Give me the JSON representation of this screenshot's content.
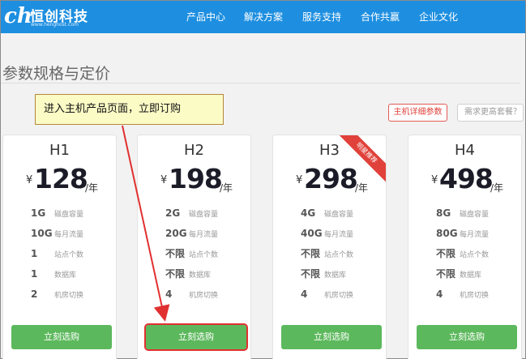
{
  "brand": {
    "mark": "ch",
    "name": "恒创科技",
    "url": "www.henghost.com"
  },
  "nav": [
    "产品中心",
    "解决方案",
    "服务支持",
    "合作共赢",
    "企业文化"
  ],
  "page": {
    "title": "参数规格与定价",
    "detail_button": "主机详细参数",
    "more_button": "需求更高套餐？"
  },
  "annotation": {
    "text": "进入主机产品页面，立即订购",
    "color": "#e13030"
  },
  "colors": {
    "nav_bg": "#1e8fe0",
    "buy_button": "#5cb85c",
    "accent_red": "#e0413a"
  },
  "plans": [
    {
      "name": "H1",
      "currency": "¥",
      "price": "128",
      "unit": "/年",
      "specs": [
        {
          "value": "1G",
          "label": "磁盘容量"
        },
        {
          "value": "10G",
          "label": "每月流量"
        },
        {
          "value": "1",
          "label": "站点个数"
        },
        {
          "value": "1",
          "label": "数据库"
        },
        {
          "value": "2",
          "label": "机房切换"
        }
      ],
      "button": "立刻选购"
    },
    {
      "name": "H2",
      "currency": "¥",
      "price": "198",
      "unit": "/年",
      "specs": [
        {
          "value": "2G",
          "label": "磁盘容量"
        },
        {
          "value": "20G",
          "label": "每月流量"
        },
        {
          "value": "不限",
          "label": "站点个数"
        },
        {
          "value": "不限",
          "label": "数据库"
        },
        {
          "value": "4",
          "label": "机房切换"
        }
      ],
      "button": "立刻选购"
    },
    {
      "name": "H3",
      "currency": "¥",
      "price": "298",
      "unit": "/年",
      "badge": "明星推荐",
      "specs": [
        {
          "value": "4G",
          "label": "磁盘容量"
        },
        {
          "value": "40G",
          "label": "每月流量"
        },
        {
          "value": "不限",
          "label": "站点个数"
        },
        {
          "value": "不限",
          "label": "数据库"
        },
        {
          "value": "4",
          "label": "机房切换"
        }
      ],
      "button": "立刻选购"
    },
    {
      "name": "H4",
      "currency": "¥",
      "price": "498",
      "unit": "/年",
      "specs": [
        {
          "value": "8G",
          "label": "磁盘容量"
        },
        {
          "value": "80G",
          "label": "每月流量"
        },
        {
          "value": "不限",
          "label": "站点个数"
        },
        {
          "value": "不限",
          "label": "数据库"
        },
        {
          "value": "4",
          "label": "机房切换"
        }
      ],
      "button": "立刻选购"
    }
  ]
}
